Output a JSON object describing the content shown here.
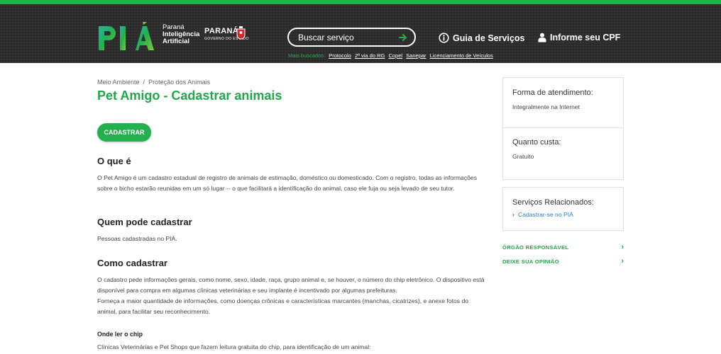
{
  "brand": {
    "logo_text": "PIÁ",
    "sub_line1": "Paraná",
    "sub_line2": "Inteligência",
    "sub_line3": "Artificial",
    "gov_name": "PARANÁ",
    "gov_sub": "GOVERNO DO ESTADO"
  },
  "search": {
    "placeholder": "Buscar serviço",
    "hot_label": "Mais buscados:",
    "hot_links": [
      "Protocolo",
      "2ª via do RG",
      "Copel",
      "Sanepar",
      "Licenciamento de Veículos"
    ]
  },
  "nav": {
    "guia": "Guia de Serviços",
    "cpf": "Informe seu CPF"
  },
  "colors": {
    "accent": "#22b14c",
    "header_bg": "#2b2b2b",
    "link_blue": "#2a7fc4"
  },
  "breadcrumb": {
    "item1": "Meio Ambiente",
    "separator": "/",
    "item2": "Proteção dos Animais"
  },
  "page": {
    "title": "Pet Amigo - Cadastrar animais",
    "cta": "CADASTRAR",
    "sections": {
      "o_que_e_title": "O que é",
      "o_que_e_text": "O Pet Amigo é um cadastro estadual de registro de animais de estimação, doméstico ou domesticado. Com o registro, todas as informações sobre o bicho estarão reunidas em um só lugar -- o que facilitará a identificação do animal, caso ele fuja ou seja levado de seu tutor.",
      "quem_title": "Quem pode cadastrar",
      "quem_text": "Pessoas cadastradas no PIÁ.",
      "como_title": "Como cadastrar",
      "como_text1": "O cadastro pede informações gerais, como nome, sexo, idade, raça, grupo animal e, se houver, o número do chip eletrônico. O dispositivo está disponível para compra em algumas clínicas veterinárias e seu implante é incentivado por algumas prefeituras.",
      "como_text2": "Forneça a maior quantidade de informações, como doenças crônicas e características marcantes (manchas, cicatrizes), e anexe fotos do animal, para facilitar seu reconhecimento.",
      "chip_title": "Onde ler o chip",
      "chip_text": "Clínicas Veterinárias e Pet Shops que fazem leitura gratuita do chip, para identificação de um animal:"
    }
  },
  "sidebar": {
    "forma_label": "Forma de atendimento:",
    "forma_value": "Integralmente na Internet",
    "custo_label": "Quanto custa:",
    "custo_value": "Gratuito",
    "relacionados_label": "Serviços Relacionados:",
    "relacionados_link": "Cadastrar-se no PIÁ",
    "orgao_link": "ÓRGÃO RESPONSÁVEL",
    "opiniao_link": "DEIXE SUA OPINIÃO"
  }
}
